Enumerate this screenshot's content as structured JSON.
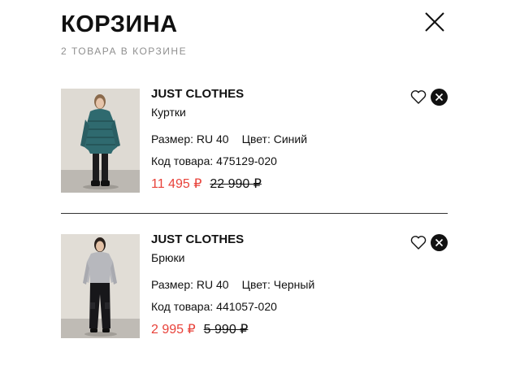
{
  "header": {
    "title": "КОРЗИНА",
    "subtitle": "2 ТОВАРА В КОРЗИНЕ",
    "close_icon": "close-icon"
  },
  "items": [
    {
      "brand": "JUST CLOTHES",
      "category": "Куртки",
      "size": "Размер: RU 40",
      "color": "Цвет: Синий",
      "sku": "Код товара: 475129-020",
      "price": "11 495 ₽",
      "old_price": "22 990 ₽",
      "image": "teal-puffer-jacket-photo",
      "favorite_icon": "heart-icon",
      "remove_icon": "close-circle-icon"
    },
    {
      "brand": "JUST CLOTHES",
      "category": "Брюки",
      "size": "Размер: RU 40",
      "color": "Цвет: Черный",
      "sku": "Код товара: 441057-020",
      "price": "2 995 ₽",
      "old_price": "5 990 ₽",
      "image": "black-cargo-pants-photo",
      "favorite_icon": "heart-icon",
      "remove_icon": "close-circle-icon"
    }
  ],
  "colors": {
    "sale_price": "#e8423a",
    "text": "#111111",
    "muted": "#8f8f8f",
    "divider": "#333333"
  }
}
